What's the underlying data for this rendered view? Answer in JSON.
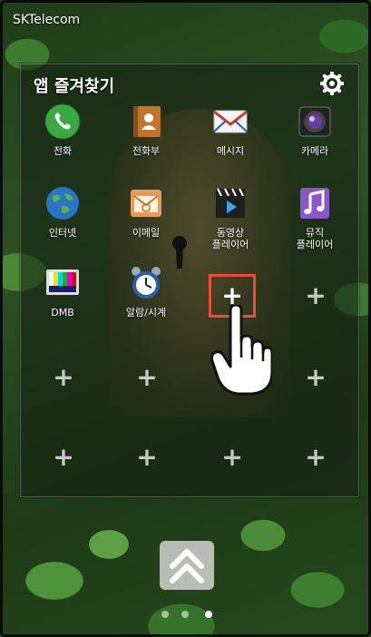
{
  "status_bar": {
    "carrier": "SKTelecom"
  },
  "panel": {
    "title": "앱 즐겨찾기",
    "settings_icon": "gear-icon"
  },
  "apps": [
    {
      "label": "전화",
      "icon": "phone-icon"
    },
    {
      "label": "전화부",
      "icon": "contacts-icon"
    },
    {
      "label": "메시지",
      "icon": "message-icon"
    },
    {
      "label": "카메라",
      "icon": "camera-icon"
    },
    {
      "label": "인터넷",
      "icon": "globe-icon"
    },
    {
      "label": "이메일",
      "icon": "email-icon"
    },
    {
      "label_line1": "동영상",
      "label_line2": "플레이어",
      "icon": "video-player-icon"
    },
    {
      "label_line1": "뮤직",
      "label_line2": "플레이어",
      "icon": "music-player-icon"
    },
    {
      "label": "DMB",
      "icon": "tv-icon"
    },
    {
      "label": "알람/시계",
      "icon": "alarm-clock-icon"
    }
  ],
  "empty_slot_glyph": "+",
  "page_indicator": {
    "count": 3,
    "active_index": 2
  },
  "colors": {
    "highlight": "#ef4b3a"
  }
}
